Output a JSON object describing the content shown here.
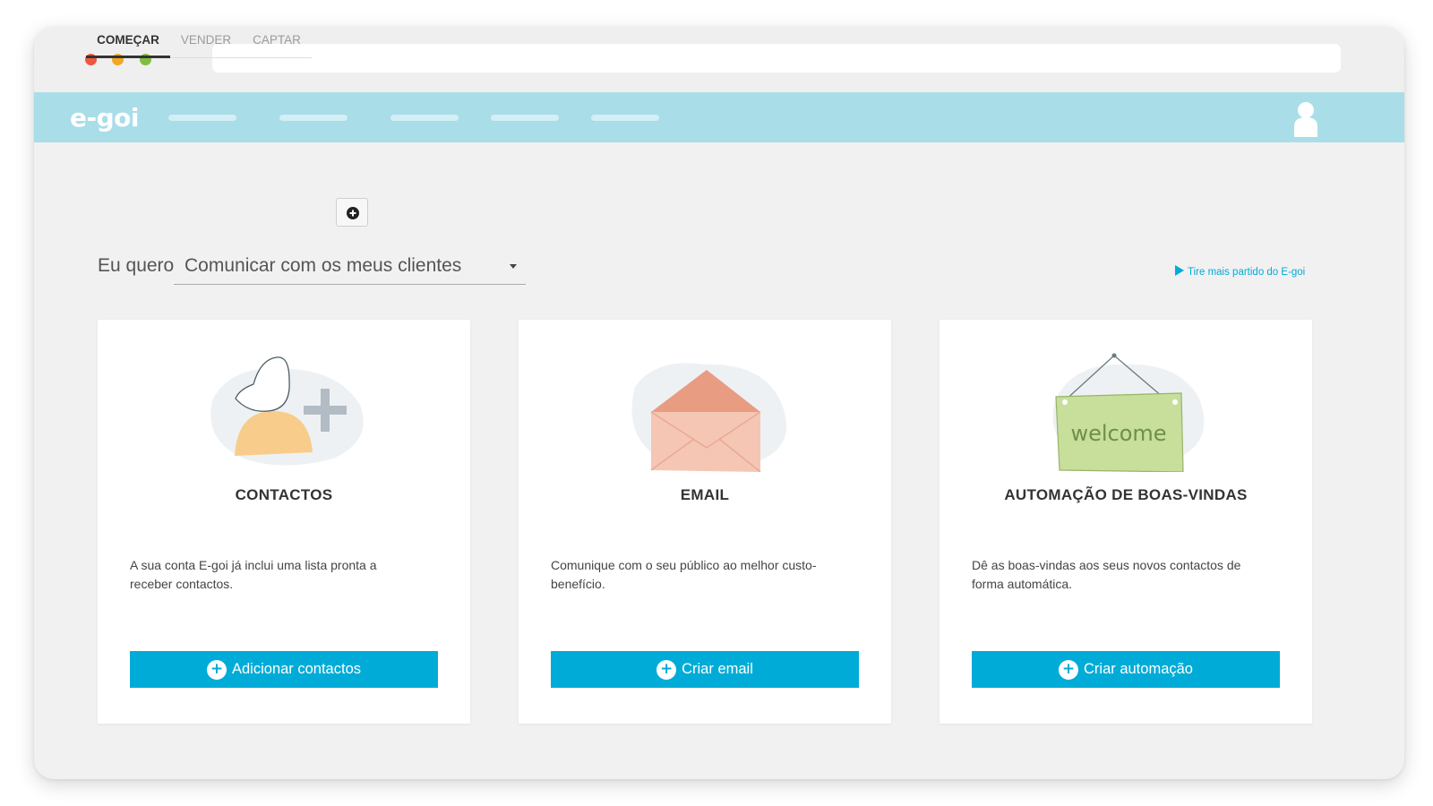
{
  "colors": {
    "accent": "#00acd7",
    "nav_bar": "#a9dde8",
    "dot_red": "#f1573c",
    "dot_yellow": "#f5a623",
    "dot_green": "#7fbf3f"
  },
  "browser": {
    "window_controls": [
      "close-dot",
      "minimize-dot",
      "maximize-dot"
    ]
  },
  "nav": {
    "logo": "e-goi",
    "avatar_icon": "user-avatar-icon"
  },
  "tabs": [
    {
      "label": "COMEÇAR",
      "active": true
    },
    {
      "label": "VENDER",
      "active": false
    },
    {
      "label": "CAPTAR",
      "active": false
    }
  ],
  "add_tab_icon": "plus-circle-icon",
  "intent": {
    "label": "Eu quero",
    "selected": "Comunicar com os meus clientes"
  },
  "help_link": {
    "label": "Tire mais partido do E-goi",
    "icon": "play-icon"
  },
  "cards": [
    {
      "icon": "add-contact-illustration",
      "title": "CONTACTOS",
      "description": "A sua conta E-goi já inclui uma lista pronta a receber contactos.",
      "button_label": "Adicionar contactos"
    },
    {
      "icon": "envelope-illustration",
      "title": "EMAIL",
      "description": "Comunique com o seu público ao melhor custo-benefício.",
      "button_label": "Criar email"
    },
    {
      "icon": "welcome-sign-illustration",
      "title": "AUTOMAÇÃO DE BOAS-VINDAS",
      "description": "Dê as boas-vindas aos seus novos contactos de forma automática.",
      "button_label": "Criar automação",
      "sign_text": "welcome"
    }
  ]
}
